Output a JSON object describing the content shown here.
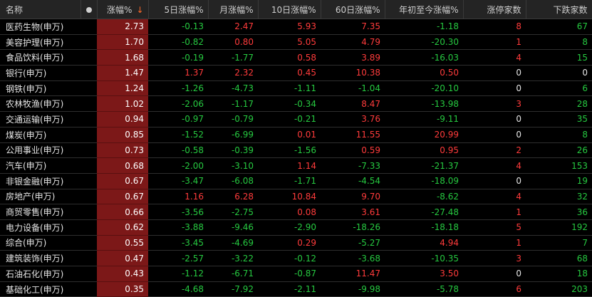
{
  "colors": {
    "up": "#ff3b3b",
    "down": "#26c940",
    "sorted_column_bg": "#7c1818",
    "header_bg": "#242424"
  },
  "header": {
    "name": "名称",
    "dot_icon": "circle-dot-icon",
    "change_pct": "涨幅%",
    "sort_icon_glyph": "↓",
    "chg_5d": "5日涨幅%",
    "chg_month": "月涨幅%",
    "chg_10d": "10日涨幅%",
    "chg_60d": "60日涨幅%",
    "chg_ytd": "年初至今涨幅%",
    "limit_up_count": "涨停家数",
    "decline_count": "下跌家数"
  },
  "rows": [
    {
      "name": "医药生物(申万)",
      "chg": "2.73",
      "d5": "-0.13",
      "mo": "2.47",
      "d10": "5.93",
      "d60": "7.35",
      "ytd": "-1.18",
      "lim": "8",
      "dn": "67"
    },
    {
      "name": "美容护理(申万)",
      "chg": "1.70",
      "d5": "-0.82",
      "mo": "0.80",
      "d10": "5.05",
      "d60": "4.79",
      "ytd": "-20.30",
      "lim": "1",
      "dn": "8"
    },
    {
      "name": "食品饮料(申万)",
      "chg": "1.68",
      "d5": "-0.19",
      "mo": "-1.77",
      "d10": "0.58",
      "d60": "3.89",
      "ytd": "-16.03",
      "lim": "4",
      "dn": "15"
    },
    {
      "name": "银行(申万)",
      "chg": "1.47",
      "d5": "1.37",
      "mo": "2.32",
      "d10": "0.45",
      "d60": "10.38",
      "ytd": "0.50",
      "lim": "0",
      "dn": "0"
    },
    {
      "name": "钢铁(申万)",
      "chg": "1.24",
      "d5": "-1.26",
      "mo": "-4.73",
      "d10": "-1.11",
      "d60": "-1.04",
      "ytd": "-20.10",
      "lim": "0",
      "dn": "6"
    },
    {
      "name": "农林牧渔(申万)",
      "chg": "1.02",
      "d5": "-2.06",
      "mo": "-1.17",
      "d10": "-0.34",
      "d60": "8.47",
      "ytd": "-13.98",
      "lim": "3",
      "dn": "28"
    },
    {
      "name": "交通运输(申万)",
      "chg": "0.94",
      "d5": "-0.97",
      "mo": "-0.79",
      "d10": "-0.21",
      "d60": "3.76",
      "ytd": "-9.11",
      "lim": "0",
      "dn": "35"
    },
    {
      "name": "煤炭(申万)",
      "chg": "0.85",
      "d5": "-1.52",
      "mo": "-6.99",
      "d10": "0.01",
      "d60": "11.55",
      "ytd": "20.99",
      "lim": "0",
      "dn": "8"
    },
    {
      "name": "公用事业(申万)",
      "chg": "0.73",
      "d5": "-0.58",
      "mo": "-0.39",
      "d10": "-1.56",
      "d60": "0.59",
      "ytd": "0.95",
      "lim": "2",
      "dn": "26"
    },
    {
      "name": "汽车(申万)",
      "chg": "0.68",
      "d5": "-2.00",
      "mo": "-3.10",
      "d10": "1.14",
      "d60": "-7.33",
      "ytd": "-21.37",
      "lim": "4",
      "dn": "153"
    },
    {
      "name": "非银金融(申万)",
      "chg": "0.67",
      "d5": "-3.47",
      "mo": "-6.08",
      "d10": "-1.71",
      "d60": "-4.54",
      "ytd": "-18.09",
      "lim": "0",
      "dn": "19"
    },
    {
      "name": "房地产(申万)",
      "chg": "0.67",
      "d5": "1.16",
      "mo": "6.28",
      "d10": "10.84",
      "d60": "9.70",
      "ytd": "-8.62",
      "lim": "4",
      "dn": "32"
    },
    {
      "name": "商贸零售(申万)",
      "chg": "0.66",
      "d5": "-3.56",
      "mo": "-2.75",
      "d10": "0.08",
      "d60": "3.61",
      "ytd": "-27.48",
      "lim": "1",
      "dn": "36"
    },
    {
      "name": "电力设备(申万)",
      "chg": "0.62",
      "d5": "-3.88",
      "mo": "-9.46",
      "d10": "-2.90",
      "d60": "-18.26",
      "ytd": "-18.18",
      "lim": "5",
      "dn": "192"
    },
    {
      "name": "综合(申万)",
      "chg": "0.55",
      "d5": "-3.45",
      "mo": "-4.69",
      "d10": "0.29",
      "d60": "-5.27",
      "ytd": "4.94",
      "lim": "1",
      "dn": "7"
    },
    {
      "name": "建筑装饰(申万)",
      "chg": "0.47",
      "d5": "-2.57",
      "mo": "-3.22",
      "d10": "-0.12",
      "d60": "-3.68",
      "ytd": "-10.35",
      "lim": "3",
      "dn": "68"
    },
    {
      "name": "石油石化(申万)",
      "chg": "0.43",
      "d5": "-1.12",
      "mo": "-6.71",
      "d10": "-0.87",
      "d60": "11.47",
      "ytd": "3.50",
      "lim": "0",
      "dn": "18"
    },
    {
      "name": "基础化工(申万)",
      "chg": "0.35",
      "d5": "-4.68",
      "mo": "-7.92",
      "d10": "-2.11",
      "d60": "-9.98",
      "ytd": "-5.78",
      "lim": "6",
      "dn": "203"
    }
  ]
}
